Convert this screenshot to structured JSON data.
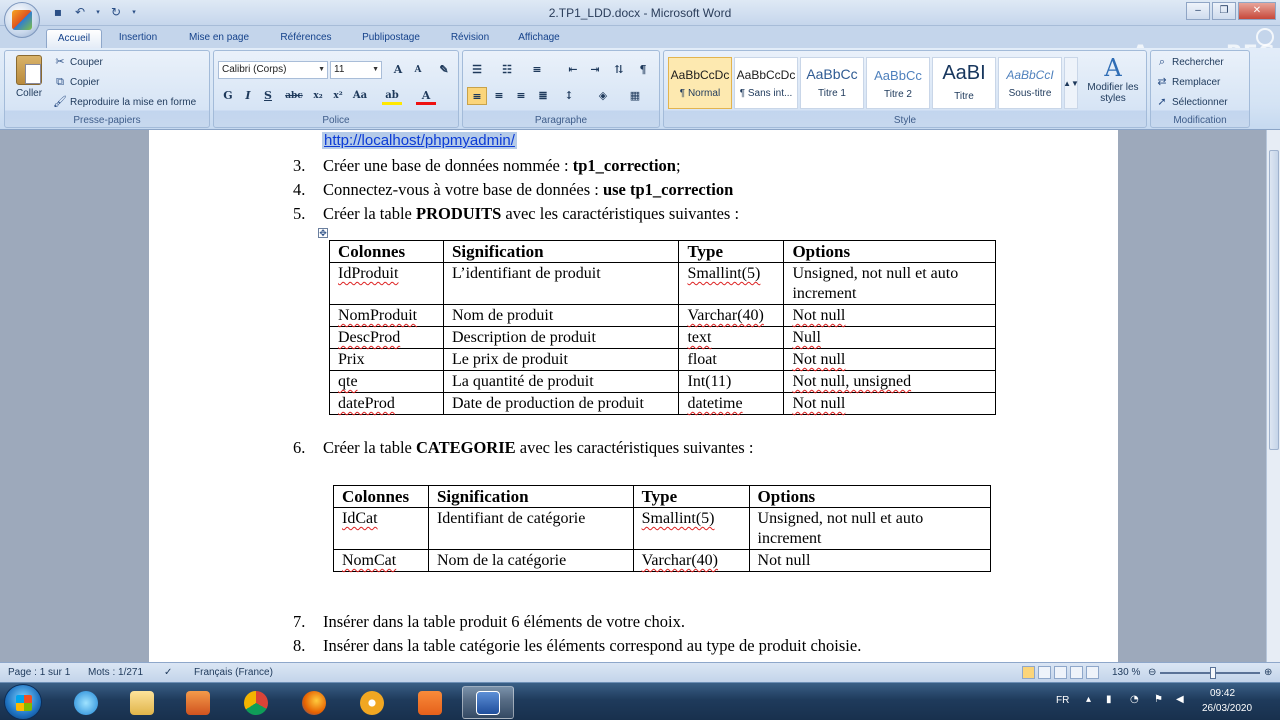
{
  "window": {
    "title": "2.TP1_LDD.docx - Microsoft Word",
    "watermark": "ApowerREC"
  },
  "tabs": [
    "Accueil",
    "Insertion",
    "Mise en page",
    "Références",
    "Publipostage",
    "Révision",
    "Affichage"
  ],
  "ribbon": {
    "clipboard": {
      "paste": "Coller",
      "cut": "Couper",
      "copy": "Copier",
      "format_painter": "Reproduire la mise en forme",
      "label": "Presse-papiers"
    },
    "font": {
      "family": "Calibri (Corps)",
      "size": "11",
      "label": "Police"
    },
    "paragraph": {
      "label": "Paragraphe"
    },
    "styles": {
      "items": [
        {
          "sample": "AaBbCcDc",
          "name": "¶ Normal"
        },
        {
          "sample": "AaBbCcDc",
          "name": "¶ Sans int..."
        },
        {
          "sample": "AaBbCc",
          "name": "Titre 1"
        },
        {
          "sample": "AaBbCc",
          "name": "Titre 2"
        },
        {
          "sample": "AaBI",
          "name": "Titre"
        },
        {
          "sample": "AaBbCcI",
          "name": "Sous-titre"
        }
      ],
      "change_styles": "Modifier les styles",
      "label": "Style"
    },
    "editing": {
      "find": "Rechercher",
      "replace": "Remplacer",
      "select": "Sélectionner",
      "label": "Modification"
    }
  },
  "document": {
    "link": "http://localhost/phpmyadmin/",
    "items": [
      {
        "num": "3.",
        "text": "Créer une  base de données nommée : ",
        "bold": "tp1_correction",
        "after": ";"
      },
      {
        "num": "4.",
        "text": "Connectez-vous à votre base de données : ",
        "bold": "use tp1_correction",
        "after": ""
      },
      {
        "num": "5.",
        "text": "Créer la table ",
        "bold": "PRODUITS",
        "after": " avec les caractéristiques suivantes :"
      },
      {
        "num": "6.",
        "text": "Créer la table ",
        "bold": "CATEGORIE",
        "after": "  avec les caractéristiques suivantes :"
      },
      {
        "num": "7.",
        "text": "Insérer dans la table produit 6 éléments de votre choix.",
        "bold": "",
        "after": ""
      },
      {
        "num": "8.",
        "text": "Insérer dans la table catégorie les éléments correspond au type de produit choisie.",
        "bold": "",
        "after": ""
      }
    ],
    "table_produits": {
      "headers": [
        "Colonnes",
        "Signification",
        "Type",
        "Options"
      ],
      "rows": [
        [
          "IdProduit",
          "L’identifiant de produit",
          "Smallint(5)",
          "Unsigned, not null et auto increment"
        ],
        [
          "NomProduit",
          "Nom de produit",
          "Varchar(40)",
          "Not null"
        ],
        [
          "DescProd",
          "Description de produit",
          "text",
          "Null"
        ],
        [
          "Prix",
          "Le prix de produit",
          "float",
          "Not null"
        ],
        [
          "qte",
          "La quantité de produit",
          "Int(11)",
          "Not null, unsigned"
        ],
        [
          "dateProd",
          "Date de production de produit",
          "datetime",
          "Not null"
        ]
      ]
    },
    "table_categorie": {
      "headers": [
        "Colonnes",
        "Signification",
        "Type",
        "Options"
      ],
      "rows": [
        [
          "IdCat",
          "Identifiant de catégorie",
          "Smallint(5)",
          "Unsigned, not null et auto increment"
        ],
        [
          "NomCat",
          "Nom de la catégorie",
          "Varchar(40)",
          "Not null"
        ]
      ]
    }
  },
  "status": {
    "page": "Page : 1 sur 1",
    "words": "Mots : 1/271",
    "language": "Français (France)",
    "zoom": "130 %"
  },
  "taskbar": {
    "lang": "FR",
    "time": "09:42",
    "date": "26/03/2020"
  }
}
